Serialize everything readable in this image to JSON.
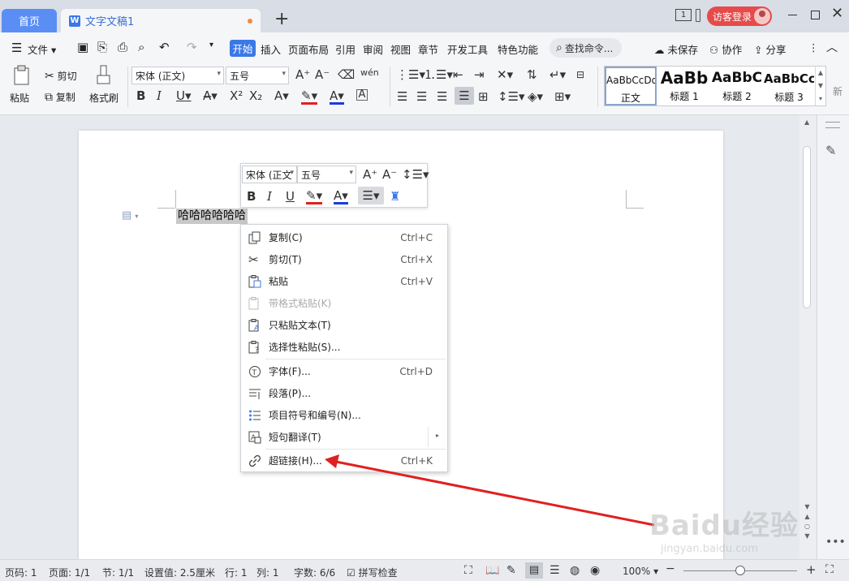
{
  "titlebar": {
    "home_tab": "首页",
    "doc_tab": "文字文稿1",
    "login": "访客登录",
    "page_badge": "1"
  },
  "menu": {
    "file": "文件",
    "tabs": [
      "开始",
      "插入",
      "页面布局",
      "引用",
      "审阅",
      "视图",
      "章节",
      "开发工具",
      "特色功能"
    ],
    "search": "查找命令...",
    "unsaved": "未保存",
    "collab": "协作",
    "share": "分享"
  },
  "ribbon": {
    "paste": "粘贴",
    "cut": "剪切",
    "copy": "复制",
    "format_painter": "格式刷",
    "font": "宋体 (正文)",
    "size": "五号",
    "styles": [
      {
        "preview": "AaBbCcDd",
        "name": "正文"
      },
      {
        "preview": "AaBb",
        "name": "标题 1"
      },
      {
        "preview": "AaBbC",
        "name": "标题 2"
      },
      {
        "preview": "AaBbCc",
        "name": "标题 3"
      }
    ],
    "more_styles": "新"
  },
  "document": {
    "text": "哈哈哈哈哈哈"
  },
  "mini_toolbar": {
    "font": "宋体 (正文",
    "size": "五号"
  },
  "context_menu": {
    "items": [
      {
        "label": "复制(C)",
        "shortcut": "Ctrl+C"
      },
      {
        "label": "剪切(T)",
        "shortcut": "Ctrl+X"
      },
      {
        "label": "粘贴",
        "shortcut": "Ctrl+V"
      },
      {
        "label": "带格式粘贴(K)",
        "shortcut": ""
      },
      {
        "label": "只粘贴文本(T)",
        "shortcut": ""
      },
      {
        "label": "选择性粘贴(S)...",
        "shortcut": ""
      },
      {
        "label": "字体(F)...",
        "shortcut": "Ctrl+D"
      },
      {
        "label": "段落(P)...",
        "shortcut": ""
      },
      {
        "label": "项目符号和编号(N)...",
        "shortcut": ""
      },
      {
        "label": "短句翻译(T)",
        "shortcut": ""
      },
      {
        "label": "超链接(H)...",
        "shortcut": "Ctrl+K"
      }
    ]
  },
  "statusbar": {
    "page_no": "页码: 1",
    "pages": "页面: 1/1",
    "section": "节: 1/1",
    "setting": "设置值: 2.5厘米",
    "row": "行: 1",
    "col": "列: 1",
    "words": "字数: 6/6",
    "spell": "拼写检查",
    "zoom": "100%"
  },
  "watermark": {
    "brand": "Baidu经验",
    "url": "jingyan.baidu.com"
  },
  "colors": {
    "accent": "#3b78e7",
    "annotation_arrow": "#e02020",
    "login": "#e64a4a"
  }
}
